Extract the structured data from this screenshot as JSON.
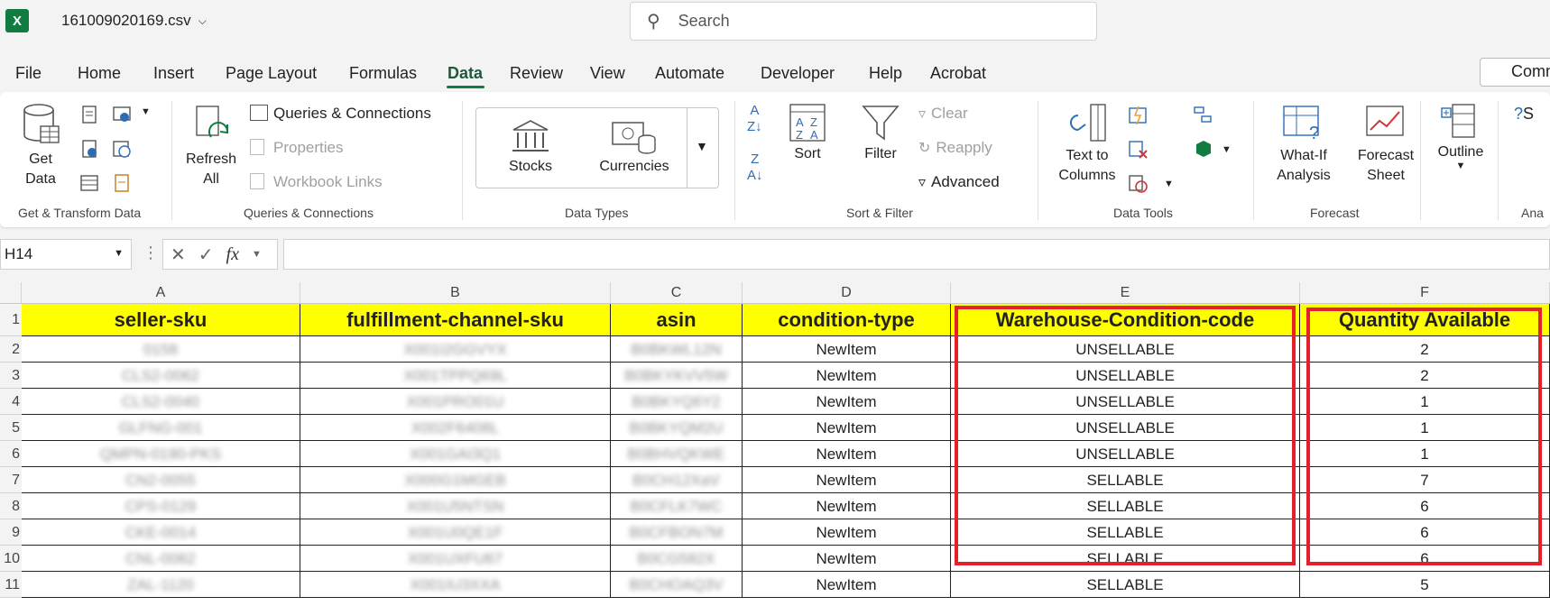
{
  "app": {
    "logo_letter": "X",
    "filename": "161009020169.csv"
  },
  "search": {
    "placeholder": "Search"
  },
  "menu": [
    "File",
    "Home",
    "Insert",
    "Page Layout",
    "Formulas",
    "Data",
    "Review",
    "View",
    "Automate",
    "Developer",
    "Help",
    "Acrobat"
  ],
  "menu_active": "Data",
  "comments_label": "Comm",
  "ribbon": {
    "get_data": "Get\nData",
    "refresh_all": "Refresh\nAll",
    "queries_connections": "Queries & Connections",
    "properties": "Properties",
    "workbook_links": "Workbook Links",
    "stocks": "Stocks",
    "currencies": "Currencies",
    "sort": "Sort",
    "filter": "Filter",
    "clear": "Clear",
    "reapply": "Reapply",
    "advanced": "Advanced",
    "text_to_columns": "Text to\nColumns",
    "what_if": "What-If\nAnalysis",
    "forecast_sheet": "Forecast\nSheet",
    "outline": "Outline",
    "groups": {
      "get_transform": "Get & Transform Data",
      "queries": "Queries & Connections",
      "data_types": "Data Types",
      "sort_filter": "Sort & Filter",
      "data_tools": "Data Tools",
      "forecast": "Forecast",
      "analysis": "Ana"
    }
  },
  "formula_bar": {
    "name_box": "H14",
    "fx": "fx",
    "formula": ""
  },
  "grid": {
    "columns": [
      "A",
      "B",
      "C",
      "D",
      "E",
      "F"
    ],
    "header_row": [
      "seller-sku",
      "fulfillment-channel-sku",
      "asin",
      "condition-type",
      "Warehouse-Condition-code",
      "Quantity Available"
    ],
    "rows": [
      {
        "num": "2",
        "a": "0158",
        "b": "X001I2GGVYX",
        "c": "B0BKWL12N",
        "d": "NewItem",
        "e": "UNSELLABLE",
        "f": "2"
      },
      {
        "num": "3",
        "a": "CLS2-0062",
        "b": "X001TPPQ69L",
        "c": "B0BKYKVV5W",
        "d": "NewItem",
        "e": "UNSELLABLE",
        "f": "2"
      },
      {
        "num": "4",
        "a": "CLS2-0040",
        "b": "X001PRO01U",
        "c": "B0BKYQ6Y2",
        "d": "NewItem",
        "e": "UNSELLABLE",
        "f": "1"
      },
      {
        "num": "5",
        "a": "GLFNG-001",
        "b": "X002F6408L",
        "c": "B0BKYQM2U",
        "d": "NewItem",
        "e": "UNSELLABLE",
        "f": "1"
      },
      {
        "num": "6",
        "a": "QMPN-0190-PKS",
        "b": "X001GAI3Q1",
        "c": "B0BHVQKWE",
        "d": "NewItem",
        "e": "UNSELLABLE",
        "f": "1"
      },
      {
        "num": "7",
        "a": "CN2-0055",
        "b": "X000G1MGEB",
        "c": "B0CH12XaV",
        "d": "NewItem",
        "e": "SELLABLE",
        "f": "7"
      },
      {
        "num": "8",
        "a": "CPS-0129",
        "b": "X001U5NTSN",
        "c": "B0CFLK7WC",
        "d": "NewItem",
        "e": "SELLABLE",
        "f": "6"
      },
      {
        "num": "9",
        "a": "CKE-0014",
        "b": "X001U0QE1F",
        "c": "B0CFBON7M",
        "d": "NewItem",
        "e": "SELLABLE",
        "f": "6"
      },
      {
        "num": "10",
        "a": "CNL-0062",
        "b": "X001UXFU67",
        "c": "B0CG582X",
        "d": "NewItem",
        "e": "SELLABLE",
        "f": "6"
      },
      {
        "num": "11",
        "a": "ZAL-1120",
        "b": "X001IU3XXA",
        "c": "B0CHOAQ3V",
        "d": "NewItem",
        "e": "SELLABLE",
        "f": "5"
      }
    ]
  },
  "colors": {
    "excel_green": "#107c41",
    "header_yellow": "#ffff00",
    "highlight_red": "#e5202a"
  }
}
